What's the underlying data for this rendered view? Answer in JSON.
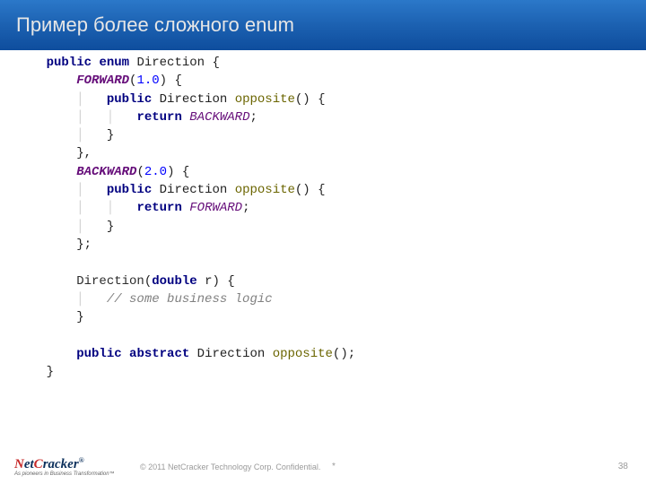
{
  "title": "Пример более сложного enum",
  "footer": {
    "logo": {
      "main": "NetCracker",
      "reg": "®",
      "sub": "As pioneers in Business Transformation™"
    },
    "copyright": "© 2011 NetCracker Technology Corp. Confidential.",
    "asterisk": "*",
    "page": "38"
  },
  "code": {
    "l1": {
      "kw1": "public",
      "kw2": "enum",
      "name": "Direction",
      "br": "{"
    },
    "l2": {
      "ec": "FORWARD",
      "lp": "(",
      "num": "1.0",
      "rp": ") {"
    },
    "l3": {
      "kw": "public",
      "type": "Direction",
      "name": "opposite",
      "tail": "() {"
    },
    "l4": {
      "kw": "return",
      "ref": "BACKWARD",
      "semi": ";"
    },
    "l5": {
      "br": "}"
    },
    "l6": {
      "br": "},"
    },
    "l7": {
      "ec": "BACKWARD",
      "lp": "(",
      "num": "2.0",
      "rp": ") {"
    },
    "l8": {
      "kw": "public",
      "type": "Direction",
      "name": "opposite",
      "tail": "() {"
    },
    "l9": {
      "kw": "return",
      "ref": "FORWARD",
      "semi": ";"
    },
    "l10": {
      "br": "}"
    },
    "l11": {
      "br": "};"
    },
    "l12": {
      "ctor": "Direction",
      "lp": "(",
      "kw": "double",
      "arg": " r",
      "rp": ") {"
    },
    "l13": {
      "com": "// some business logic"
    },
    "l14": {
      "br": "}"
    },
    "l15": {
      "kw1": "public",
      "kw2": "abstract",
      "type": "Direction",
      "name": "opposite",
      "tail": "();"
    },
    "l16": {
      "br": "}"
    }
  }
}
